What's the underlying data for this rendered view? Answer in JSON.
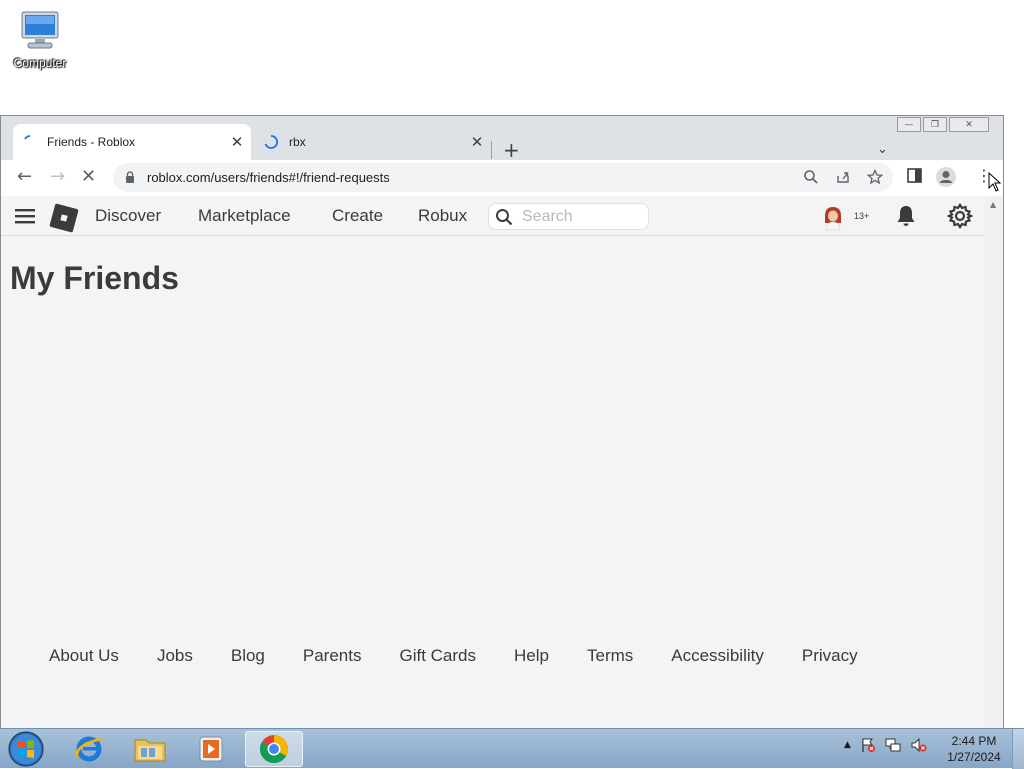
{
  "desktop": {
    "icons": [
      {
        "label": "Computer",
        "icon": "computer-icon"
      }
    ]
  },
  "browser": {
    "tabs": [
      {
        "title": "Friends - Roblox",
        "active": true,
        "loading": true
      },
      {
        "title": "rbx",
        "active": false,
        "loading": true
      }
    ],
    "url": "roblox.com/users/friends#!/friend-requests"
  },
  "roblox": {
    "nav": {
      "links": [
        "Discover",
        "Marketplace",
        "Create",
        "Robux"
      ],
      "search_placeholder": "Search",
      "age_badge": "13+"
    },
    "page_title": "My Friends",
    "footer_links": [
      "About Us",
      "Jobs",
      "Blog",
      "Parents",
      "Gift Cards",
      "Help",
      "Terms",
      "Accessibility",
      "Privacy"
    ]
  },
  "taskbar": {
    "time": "2:44 PM",
    "date": "1/27/2024",
    "apps": [
      "internet-explorer-icon",
      "file-explorer-icon",
      "media-player-icon",
      "chrome-icon"
    ]
  }
}
